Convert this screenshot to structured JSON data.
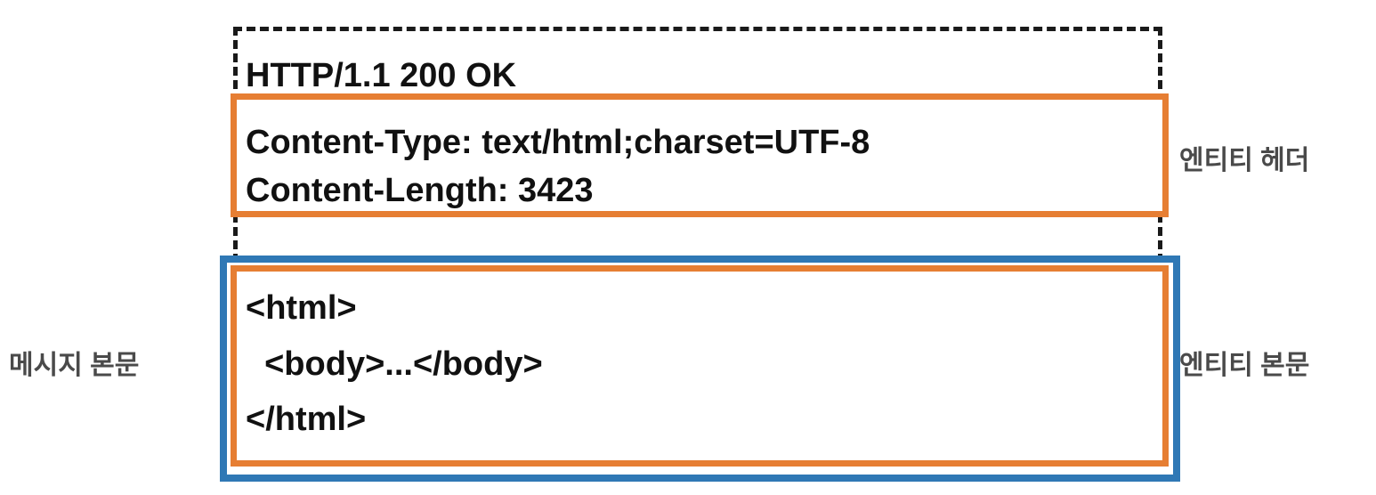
{
  "left_partial_text": ")",
  "message_start_line": "HTTP/1.1 200 OK",
  "entity_headers": [
    "Content-Type: text/html;charset=UTF-8",
    "Content-Length: 3423"
  ],
  "body_lines": [
    "<html>",
    "  <body>...</body>",
    "</html>"
  ],
  "labels": {
    "entity_header": "엔티티 헤더",
    "message_body": "메시지 본문",
    "entity_body": "엔티티 본문"
  },
  "colors": {
    "entity_outline": "#e67e33",
    "message_body_outline": "#2f78b5",
    "message_frame": "#1a1a1a",
    "text": "#111111",
    "label_text": "#4a4a4a"
  }
}
